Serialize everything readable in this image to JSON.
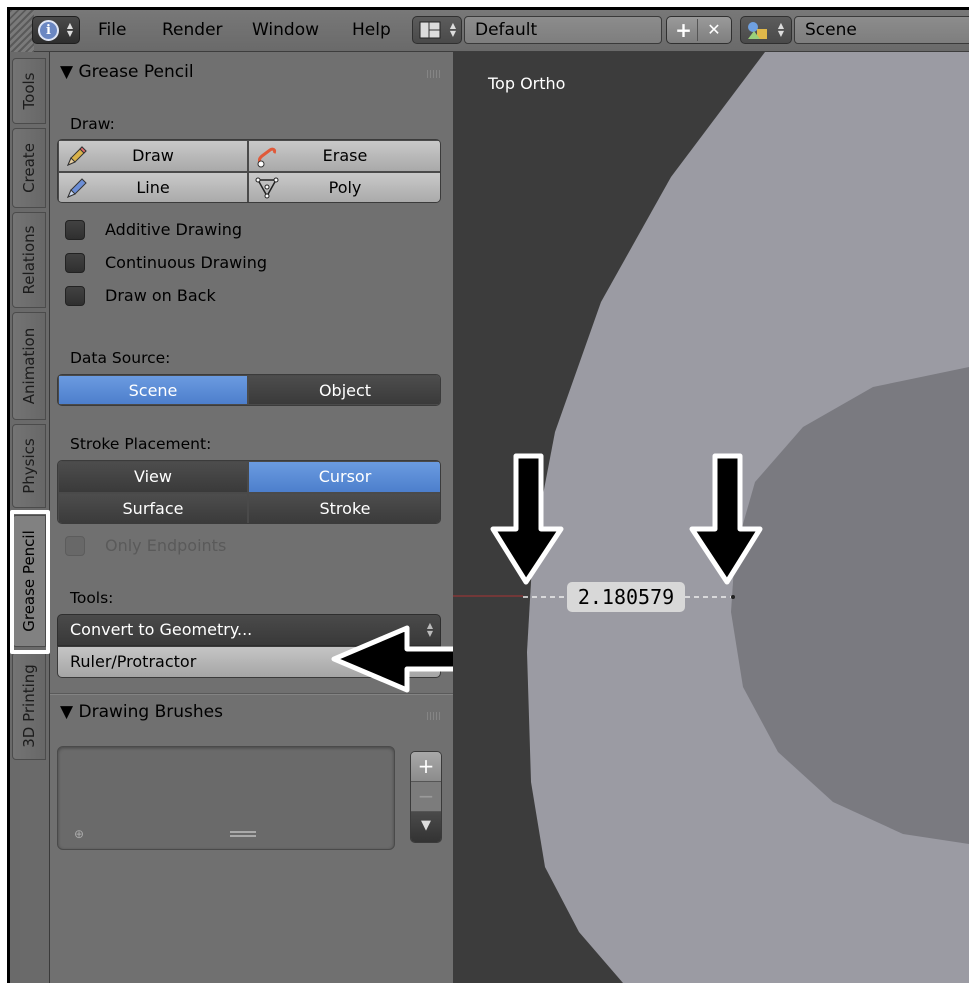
{
  "header": {
    "menus": [
      "File",
      "Render",
      "Window",
      "Help"
    ],
    "layout_name": "Default",
    "scene_name": "Scene"
  },
  "tabs": [
    "Tools",
    "Create",
    "Relations",
    "Animation",
    "Physics",
    "Grease Pencil",
    "3D Printing"
  ],
  "active_tab": "Grease Pencil",
  "grease_pencil": {
    "title": "Grease Pencil",
    "draw_label": "Draw:",
    "draw_button": "Draw",
    "erase_button": "Erase",
    "line_button": "Line",
    "poly_button": "Poly",
    "additive_drawing": "Additive Drawing",
    "continuous_drawing": "Continuous Drawing",
    "draw_on_back": "Draw on Back",
    "data_source_label": "Data Source:",
    "data_source_scene": "Scene",
    "data_source_object": "Object",
    "stroke_placement_label": "Stroke Placement:",
    "placement_view": "View",
    "placement_cursor": "Cursor",
    "placement_surface": "Surface",
    "placement_stroke": "Stroke",
    "only_endpoints": "Only Endpoints",
    "tools_label": "Tools:",
    "convert_to_geometry": "Convert to Geometry...",
    "ruler_protractor": "Ruler/Protractor"
  },
  "drawing_brushes": {
    "title": "Drawing Brushes",
    "add_symbol": "+",
    "remove_symbol": "−"
  },
  "viewport": {
    "view_label": "Top Ortho",
    "measurement": "2.180579"
  },
  "colors": {
    "accent_blue": "#5b8cd8",
    "viewport_bg": "#3c3c3c",
    "outer_disc": "#9b9ba3",
    "inner_disc": "#7a7a80"
  }
}
